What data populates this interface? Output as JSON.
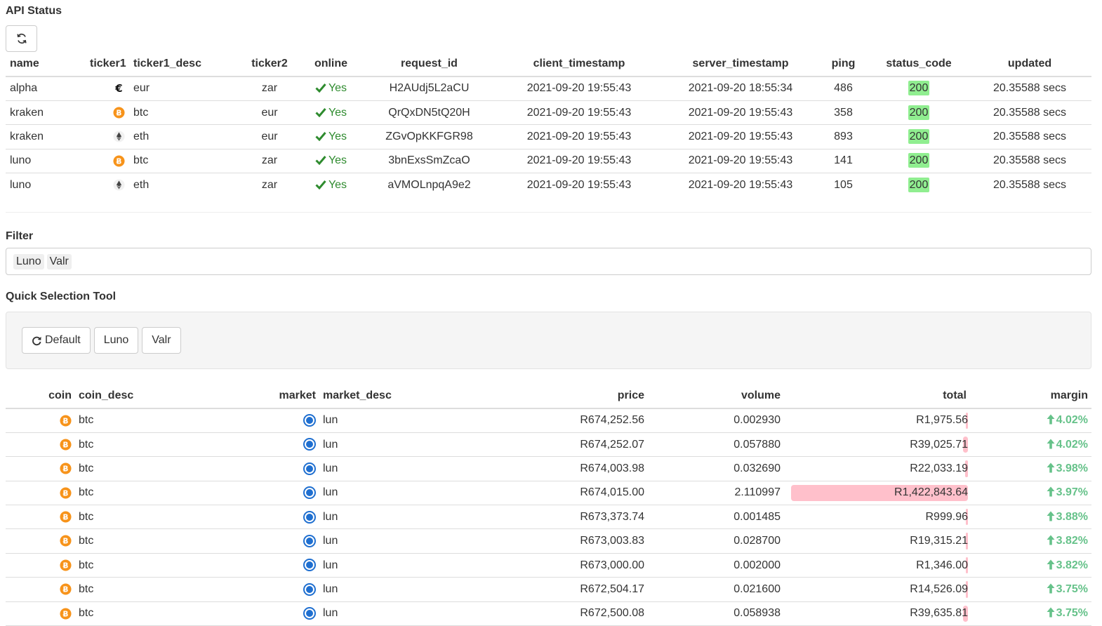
{
  "api_status": {
    "title": "API Status",
    "refresh_icon": "refresh-icon",
    "columns": [
      "name",
      "ticker1",
      "ticker1_desc",
      "ticker2",
      "online",
      "request_id",
      "client_timestamp",
      "server_timestamp",
      "ping",
      "status_code",
      "updated"
    ],
    "rows": [
      {
        "name": "alpha",
        "ticker1_icon": "euro-icon",
        "ticker1_desc": "eur",
        "ticker2": "zar",
        "online": "Yes",
        "request_id": "H2AUdj5L2aCU",
        "client_timestamp": "2021-09-20 19:55:43",
        "server_timestamp": "2021-09-20 18:55:34",
        "ping": "486",
        "status_code": "200",
        "updated": "20.35588 secs"
      },
      {
        "name": "kraken",
        "ticker1_icon": "bitcoin-icon",
        "ticker1_desc": "btc",
        "ticker2": "eur",
        "online": "Yes",
        "request_id": "QrQxDN5tQ20H",
        "client_timestamp": "2021-09-20 19:55:43",
        "server_timestamp": "2021-09-20 19:55:43",
        "ping": "358",
        "status_code": "200",
        "updated": "20.35588 secs"
      },
      {
        "name": "kraken",
        "ticker1_icon": "ethereum-icon",
        "ticker1_desc": "eth",
        "ticker2": "eur",
        "online": "Yes",
        "request_id": "ZGvOpKKFGR98",
        "client_timestamp": "2021-09-20 19:55:43",
        "server_timestamp": "2021-09-20 19:55:43",
        "ping": "893",
        "status_code": "200",
        "updated": "20.35588 secs"
      },
      {
        "name": "luno",
        "ticker1_icon": "bitcoin-icon",
        "ticker1_desc": "btc",
        "ticker2": "zar",
        "online": "Yes",
        "request_id": "3bnExsSmZcaO",
        "client_timestamp": "2021-09-20 19:55:43",
        "server_timestamp": "2021-09-20 19:55:43",
        "ping": "141",
        "status_code": "200",
        "updated": "20.35588 secs"
      },
      {
        "name": "luno",
        "ticker1_icon": "ethereum-icon",
        "ticker1_desc": "eth",
        "ticker2": "zar",
        "online": "Yes",
        "request_id": "aVMOLnpqA9e2",
        "client_timestamp": "2021-09-20 19:55:43",
        "server_timestamp": "2021-09-20 19:55:43",
        "ping": "105",
        "status_code": "200",
        "updated": "20.35588 secs"
      }
    ]
  },
  "filter": {
    "title": "Filter",
    "chips": [
      "Luno",
      "Valr"
    ]
  },
  "quick_selection": {
    "title": "Quick Selection Tool",
    "buttons": [
      {
        "label": "Default",
        "icon": "redo-icon"
      },
      {
        "label": "Luno"
      },
      {
        "label": "Valr"
      }
    ]
  },
  "market": {
    "columns": [
      "coin",
      "coin_desc",
      "market",
      "market_desc",
      "price",
      "volume",
      "total",
      "margin"
    ],
    "bar_max_total": 1422843.64,
    "rows": [
      {
        "coin_icon": "bitcoin-icon",
        "coin_desc": "btc",
        "market_icon": "luno-icon",
        "market_desc": "lun",
        "price": "R674,252.56",
        "volume": "0.002930",
        "total": "R1,975.56",
        "total_value": 1975.56,
        "margin": "4.02%"
      },
      {
        "coin_icon": "bitcoin-icon",
        "coin_desc": "btc",
        "market_icon": "luno-icon",
        "market_desc": "lun",
        "price": "R674,252.07",
        "volume": "0.057880",
        "total": "R39,025.71",
        "total_value": 39025.71,
        "margin": "4.02%"
      },
      {
        "coin_icon": "bitcoin-icon",
        "coin_desc": "btc",
        "market_icon": "luno-icon",
        "market_desc": "lun",
        "price": "R674,003.98",
        "volume": "0.032690",
        "total": "R22,033.19",
        "total_value": 22033.19,
        "margin": "3.98%"
      },
      {
        "coin_icon": "bitcoin-icon",
        "coin_desc": "btc",
        "market_icon": "luno-icon",
        "market_desc": "lun",
        "price": "R674,015.00",
        "volume": "2.110997",
        "total": "R1,422,843.64",
        "total_value": 1422843.64,
        "margin": "3.97%"
      },
      {
        "coin_icon": "bitcoin-icon",
        "coin_desc": "btc",
        "market_icon": "luno-icon",
        "market_desc": "lun",
        "price": "R673,373.74",
        "volume": "0.001485",
        "total": "R999.96",
        "total_value": 999.96,
        "margin": "3.88%"
      },
      {
        "coin_icon": "bitcoin-icon",
        "coin_desc": "btc",
        "market_icon": "luno-icon",
        "market_desc": "lun",
        "price": "R673,003.83",
        "volume": "0.028700",
        "total": "R19,315.21",
        "total_value": 19315.21,
        "margin": "3.82%"
      },
      {
        "coin_icon": "bitcoin-icon",
        "coin_desc": "btc",
        "market_icon": "luno-icon",
        "market_desc": "lun",
        "price": "R673,000.00",
        "volume": "0.002000",
        "total": "R1,346.00",
        "total_value": 1346.0,
        "margin": "3.82%"
      },
      {
        "coin_icon": "bitcoin-icon",
        "coin_desc": "btc",
        "market_icon": "luno-icon",
        "market_desc": "lun",
        "price": "R672,504.17",
        "volume": "0.021600",
        "total": "R14,526.09",
        "total_value": 14526.09,
        "margin": "3.75%"
      },
      {
        "coin_icon": "bitcoin-icon",
        "coin_desc": "btc",
        "market_icon": "luno-icon",
        "market_desc": "lun",
        "price": "R672,500.08",
        "volume": "0.058938",
        "total": "R39,635.81",
        "total_value": 39635.81,
        "margin": "3.75%"
      }
    ]
  },
  "colors": {
    "status_ok_bg": "#90ee90",
    "online_green": "#2e8b2e",
    "margin_green": "#66c28a",
    "total_bar": "#ffc0cb",
    "bitcoin_orange": "#f7931a",
    "luno_blue": "#1f6fd0"
  }
}
